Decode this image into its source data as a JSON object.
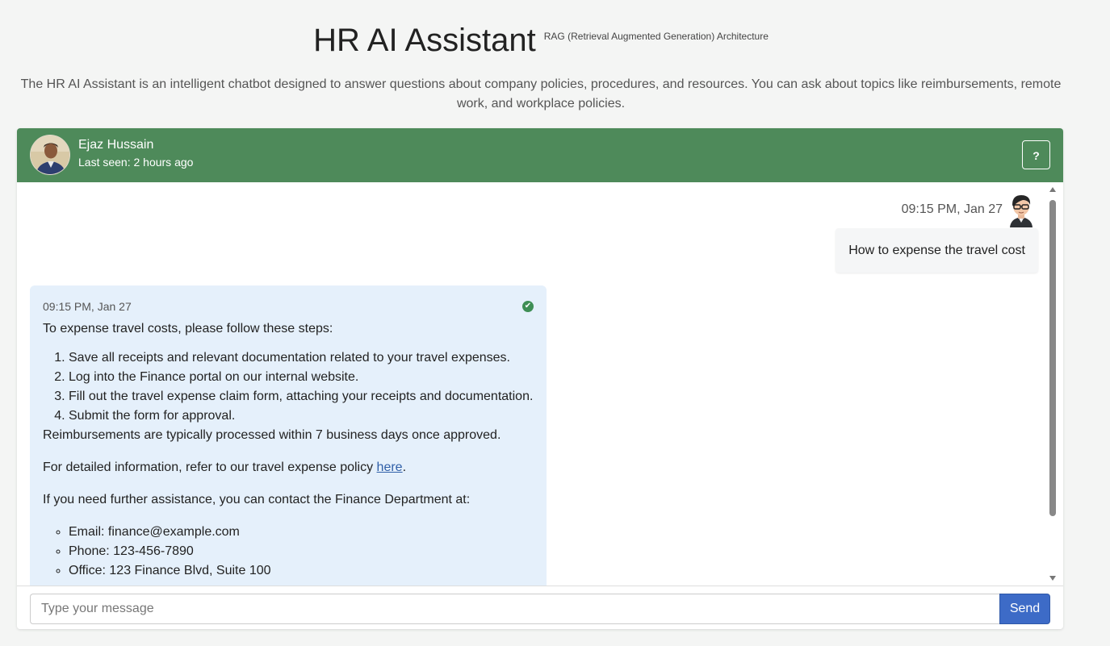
{
  "page": {
    "title": "HR AI Assistant",
    "subtitle": "RAG (Retrieval Augmented Generation) Architecture",
    "intro": "The HR AI Assistant is an intelligent chatbot designed to answer questions about company policies, procedures, and resources. You can ask about topics like reimbursements, remote work, and workplace policies."
  },
  "chat_header": {
    "name": "Ejaz Hussain",
    "last_seen": "Last seen: 2 hours ago",
    "help_label": "?",
    "header_color": "#4e8a5a"
  },
  "messages": {
    "user": {
      "time": "09:15 PM, Jan 27",
      "text": "How to expense the travel cost"
    },
    "bot": {
      "time": "09:15 PM, Jan 27",
      "intro": "To expense travel costs, please follow these steps:",
      "steps": [
        "Save all receipts and relevant documentation related to your travel expenses.",
        "Log into the Finance portal on our internal website.",
        "Fill out the travel expense claim form, attaching your receipts and documentation.",
        "Submit the form for approval."
      ],
      "reimbursement_note": "Reimbursements are typically processed within 7 business days once approved.",
      "policy_text": "For detailed information, refer to our travel expense policy ",
      "policy_link": "here",
      "policy_end": ".",
      "contact_intro": "If you need further assistance, you can contact the Finance Department at:",
      "contacts": [
        "Email: finance@example.com",
        "Phone: 123-456-7890",
        "Office: 123 Finance Blvd, Suite 100"
      ]
    }
  },
  "composer": {
    "placeholder": "Type your message",
    "send_label": "Send"
  }
}
